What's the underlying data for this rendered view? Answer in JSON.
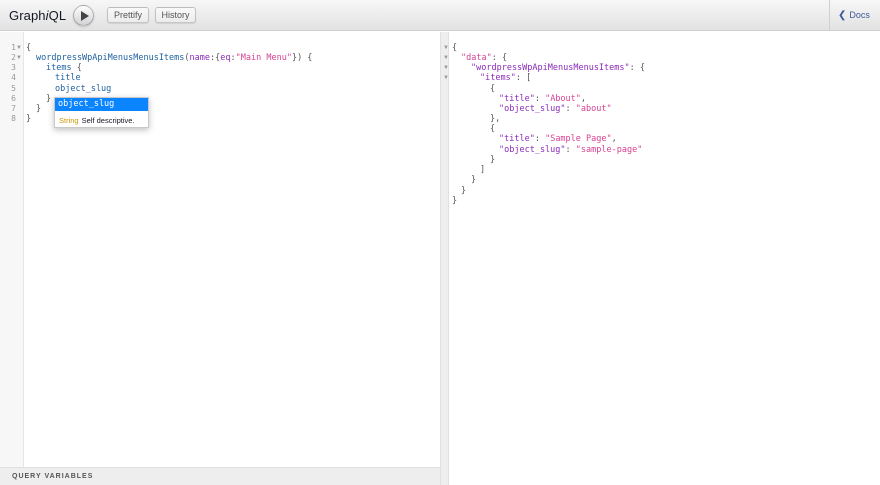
{
  "app": {
    "title_prefix": "Graph",
    "title_italic": "i",
    "title_suffix": "QL",
    "prettify_label": "Prettify",
    "history_label": "History",
    "docs_label": "Docs",
    "docs_chevron": "❮"
  },
  "editor": {
    "line_numbers": [
      "1",
      "2",
      "3",
      "4",
      "5",
      "6",
      "7",
      "8"
    ],
    "query": {
      "open_brace": "{",
      "field": "wordpressWpApiMenusMenusItems",
      "paren_open": "(",
      "arg_name": "name",
      "colon": ":",
      "obj_open": "{",
      "arg_key": "eq",
      "arg_value": "\"Main Menu\"",
      "obj_close": "}",
      "paren_close": ")",
      "space_brace": " {",
      "items": "items",
      "items_brace": " {",
      "title": "title",
      "object_slug": "object_slug",
      "close_items": "}",
      "close_field": "}",
      "close_root": "}"
    }
  },
  "autocomplete": {
    "selected": "object_slug",
    "type": "String",
    "description": "Self descriptive."
  },
  "result": {
    "open": "{",
    "data_key": "\"data\"",
    "colon": ": ",
    "brace": "{",
    "menus_key": "\"wordpressWpApiMenusMenusItems\"",
    "items_key": "\"items\"",
    "bracket": "[",
    "item1": {
      "title_key": "\"title\"",
      "title_value": "\"About\"",
      "slug_key": "\"object_slug\"",
      "slug_value": "\"about\""
    },
    "item2": {
      "title_key": "\"title\"",
      "title_value": "\"Sample Page\"",
      "slug_key": "\"object_slug\"",
      "slug_value": "\"sample-page\""
    },
    "comma": ",",
    "close_obj": "}",
    "close_obj_comma": "},",
    "close_bracket": "]"
  },
  "query_variables_label": "QUERY VARIABLES"
}
